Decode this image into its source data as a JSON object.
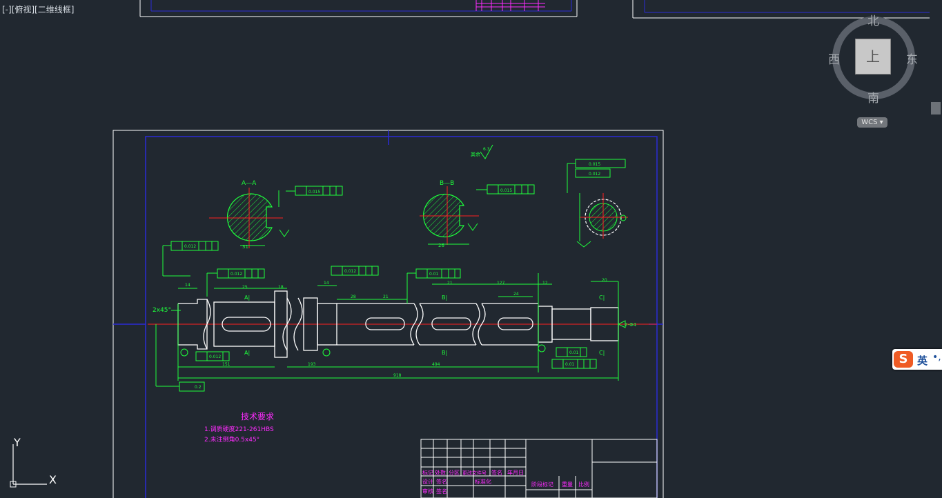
{
  "viewport": {
    "label": "[-][俯视][二维线框]"
  },
  "viewcube": {
    "north": "北",
    "south": "南",
    "east": "东",
    "west": "西",
    "face_label": "上",
    "wcs_label": "WCS ▾"
  },
  "ime": {
    "logo": "S",
    "language": "英",
    "dot": "•,"
  },
  "ucs_icon": {
    "x_label": "X",
    "y_label": "Y"
  },
  "drawing": {
    "section_a_title": "A—A",
    "section_b_title": "B—B",
    "roughness_note": "其余",
    "roughness_main": "6.3",
    "tolerance_a": [
      "0.015",
      "B",
      "C",
      "D"
    ],
    "tolerance_b": [
      "0.015",
      "B",
      "C",
      "D"
    ],
    "tolerance_gear_1": [
      "0.015",
      "A",
      "B"
    ],
    "tolerance_gear_2": [
      "0.012",
      "A"
    ],
    "tol_left": [
      "0.012",
      "B",
      "C",
      "D"
    ],
    "tol_mid1": [
      "0.012",
      "B",
      "C",
      "D"
    ],
    "tol_mid2": [
      "0.012",
      "B",
      "C",
      "D"
    ],
    "tol_mid3": [
      "0.01",
      "B",
      "C",
      "D"
    ],
    "tol_right1": [
      "0.01",
      "C"
    ],
    "tol_right2": [
      "0.01",
      "B",
      "C",
      "D"
    ],
    "tol_bottom": [
      "0.012",
      "C"
    ],
    "tol_flat": "0.2",
    "chamfer": "2x45°",
    "dim_a_width": "31",
    "dim_b_width": "26",
    "dims_top": [
      "14",
      "25",
      "18",
      "14",
      "28",
      "21",
      "21",
      "127",
      "24",
      "12",
      "20"
    ],
    "dims_bottom": [
      "151",
      "193",
      "494",
      "918"
    ],
    "section_labels": [
      "A|",
      "A|",
      "B|",
      "B|",
      "C|",
      "C|"
    ],
    "arrow_note": "2-Φ4",
    "tech_title": "技术要求",
    "tech_lines": [
      "1.调质硬度221-261HBS",
      "2.未注倒角0.5x45°"
    ],
    "title_block": {
      "row1": [
        "标记",
        "处数",
        "分区",
        "更改文件号",
        "签名",
        "年月日"
      ],
      "row2": [
        "设计",
        "签名",
        "",
        "标准化",
        "",
        ""
      ],
      "row3": [
        "审核",
        "签名",
        "",
        "",
        "",
        ""
      ],
      "right": [
        "阶段标记",
        "重量",
        "比例"
      ]
    }
  }
}
